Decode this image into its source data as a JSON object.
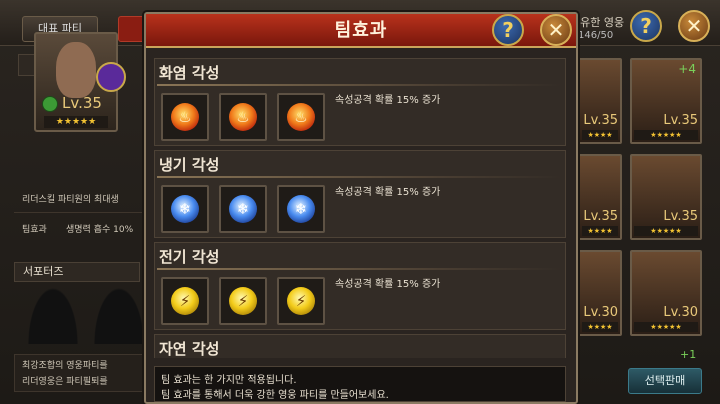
{
  "background": {
    "top_tab_label": "대표 파티",
    "left_panel": {
      "team_label": "팀",
      "hero_level": "Lv.35",
      "hero_stars": "★★★★★",
      "leader_skill_text": "리더스킬 파티원의 최대생",
      "team_effect_label": "팀효과",
      "team_effect_value": "생명력 흡수 10%",
      "supporters_label": "서포터즈",
      "bottom_text_1": "최강조합의 영웅파티를",
      "bottom_text_2": "리더영웅은 파티필퇴를"
    },
    "right_panel": {
      "header_text": "보유한 영웅",
      "count_text": "146/50",
      "tiles": [
        {
          "level": "Lv.35",
          "stars": "★★★★"
        },
        {
          "level": "Lv.35",
          "stars": "★★★★★"
        },
        {
          "level": "Lv.35",
          "stars": "★★★★"
        },
        {
          "level": "Lv.35",
          "stars": "★★★★★"
        },
        {
          "level": "Lv.30",
          "stars": "★★★★"
        },
        {
          "level": "Lv.30",
          "stars": "★★★★★"
        }
      ],
      "plus_badge_1": "+4",
      "plus_badge_2": "+1",
      "sell_button_label": "선택판매"
    },
    "help_icon_glyph": "?",
    "close_icon_glyph": "✕"
  },
  "modal": {
    "title": "팀효과",
    "help_icon_glyph": "?",
    "close_icon_glyph": "✕",
    "sections": [
      {
        "title": "화염 각성",
        "description": "속성공격 확률 15% 증가",
        "icon": "fire-orb-icon",
        "glyph": "♨"
      },
      {
        "title": "냉기 각성",
        "description": "속성공격 확률 15% 증가",
        "icon": "frost-orb-icon",
        "glyph": "❄"
      },
      {
        "title": "전기 각성",
        "description": "속성공격 확률 15% 증가",
        "icon": "lightning-orb-icon",
        "glyph": "⚡"
      },
      {
        "title": "자연 각성",
        "description": "",
        "icon": "",
        "glyph": ""
      }
    ],
    "footer_line_1": "팀 효과는 한 가지만 적용됩니다.",
    "footer_line_2": "팀 효과를 통해서 더욱 강한 영웅 파티를 만들어보세요."
  },
  "colors": {
    "header_red": "#b8321c",
    "gold_trim": "#caa45a",
    "panel_bg": "#332c26"
  }
}
